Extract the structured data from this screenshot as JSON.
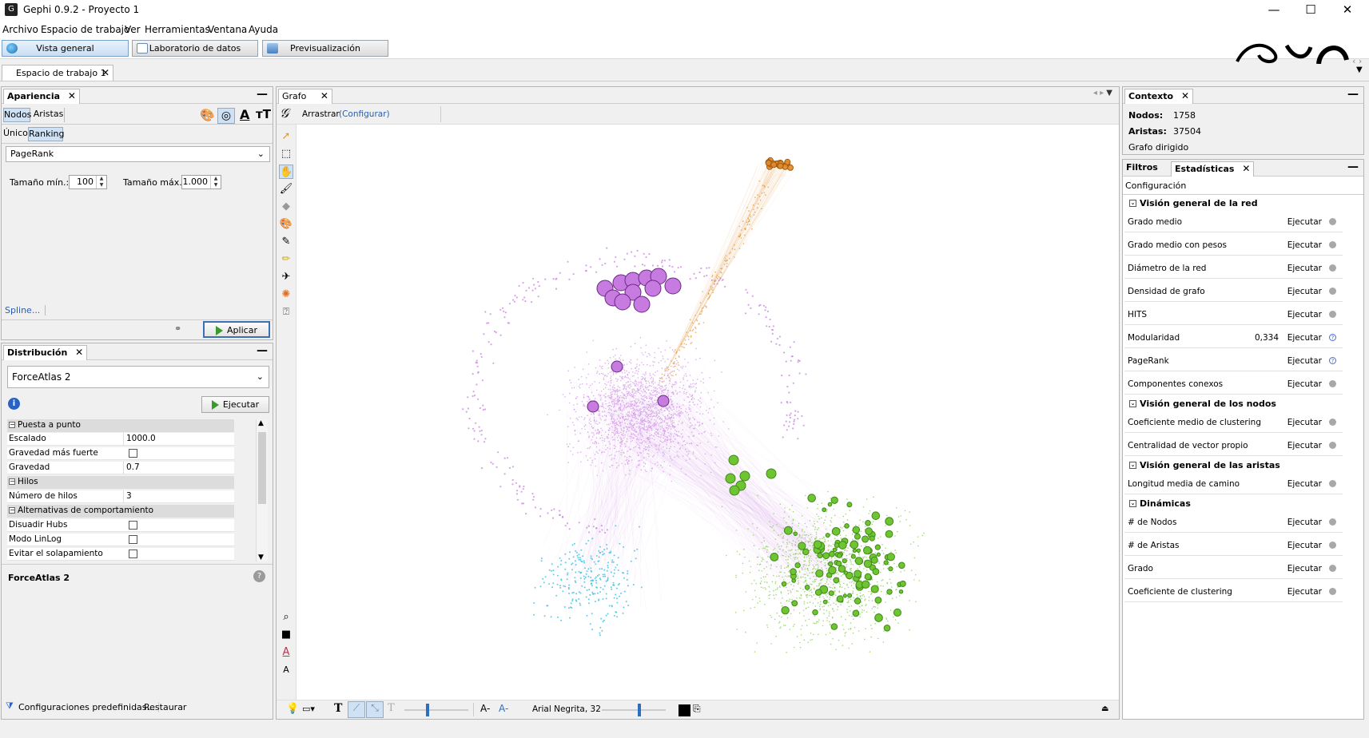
{
  "window": {
    "title": "Gephi 0.9.2 - Proyecto 1",
    "app_icon_glyph": "G",
    "controls": {
      "minimize": "—",
      "maximize": "☐",
      "close": "✕"
    }
  },
  "menu": [
    "Archivo",
    "Espacio de trabajo",
    "Ver",
    "Herramientas",
    "Ventana",
    "Ayuda"
  ],
  "top_tabs": [
    {
      "label": "Vista general",
      "active": true
    },
    {
      "label": "Laboratorio de datos",
      "active": false
    },
    {
      "label": "Previsualización",
      "active": false
    }
  ],
  "workspace_tab": {
    "label": "Espacio de trabajo 1"
  },
  "appearance": {
    "title": "Apariencia",
    "tabs": [
      "Nodos",
      "Aristas"
    ],
    "mode_tabs": [
      "Único",
      "Ranking"
    ],
    "attribute": "PageRank",
    "min_label": "Tamaño mín.:",
    "min_value": "100",
    "max_label": "Tamaño máx.:",
    "max_value": "1.000",
    "spline": "Spline...",
    "apply": "Aplicar"
  },
  "layout": {
    "title": "Distribución",
    "algorithm": "ForceAtlas 2",
    "run": "Ejecutar",
    "categories": {
      "tuning": "Puesta a punto",
      "threads": "Hilos",
      "behavior": "Alternativas de comportamiento"
    },
    "props": {
      "scaling": {
        "label": "Escalado",
        "value": "1000.0"
      },
      "stronger_gravity": {
        "label": "Gravedad más fuerte"
      },
      "gravity": {
        "label": "Gravedad",
        "value": "0.7"
      },
      "threads": {
        "label": "Número de hilos",
        "value": "3"
      },
      "dissuade": {
        "label": "Disuadir Hubs"
      },
      "linlog": {
        "label": "Modo LinLog"
      },
      "overlap": {
        "label": "Evitar el solapamiento"
      }
    },
    "description_title": "ForceAtlas 2",
    "presets": "Configuraciones predefinidas...",
    "restore": "Restaurar"
  },
  "graph": {
    "tab": "Grafo",
    "tool": "Arrastrar",
    "configure": "(Configurar)",
    "font_label": "Arial Negrita, 32",
    "clusters": [
      {
        "name": "purple",
        "color": "#c77be0"
      },
      {
        "name": "green",
        "color": "#6fc531"
      },
      {
        "name": "cyan",
        "color": "#3ac0e0"
      },
      {
        "name": "orange",
        "color": "#e08a2a"
      }
    ]
  },
  "context": {
    "title": "Contexto",
    "nodes_label": "Nodos:",
    "nodes_value": "1758",
    "edges_label": "Aristas:",
    "edges_value": "37504",
    "graph_type": "Grafo dirigido"
  },
  "stats": {
    "tabs": [
      "Filtros",
      "Estadísticas"
    ],
    "config": "Configuración",
    "run_label": "Ejecutar",
    "groups": [
      {
        "title": "Visión general de la red",
        "rows": [
          {
            "label": "Grado medio",
            "value": "",
            "help": false
          },
          {
            "label": "Grado medio con pesos",
            "value": "",
            "help": false
          },
          {
            "label": "Diámetro de la red",
            "value": "",
            "help": false
          },
          {
            "label": "Densidad de grafo",
            "value": "",
            "help": false
          },
          {
            "label": "HITS",
            "value": "",
            "help": false
          },
          {
            "label": "Modularidad",
            "value": "0,334",
            "help": true
          },
          {
            "label": "PageRank",
            "value": "",
            "help": true
          },
          {
            "label": "Componentes conexos",
            "value": "",
            "help": false
          }
        ]
      },
      {
        "title": "Visión general de los nodos",
        "rows": [
          {
            "label": "Coeficiente medio de clustering",
            "value": "",
            "help": false
          },
          {
            "label": "Centralidad de vector propio",
            "value": "",
            "help": false
          }
        ]
      },
      {
        "title": "Visión general de las aristas",
        "rows": [
          {
            "label": "Longitud media de camino",
            "value": "",
            "help": false
          }
        ]
      },
      {
        "title": "Dinámicas",
        "rows": [
          {
            "label": "# de Nodos",
            "value": "",
            "help": false
          },
          {
            "label": "# de Aristas",
            "value": "",
            "help": false
          },
          {
            "label": "Grado",
            "value": "",
            "help": false
          },
          {
            "label": "Coeficiente de clustering",
            "value": "",
            "help": false
          }
        ]
      }
    ]
  }
}
